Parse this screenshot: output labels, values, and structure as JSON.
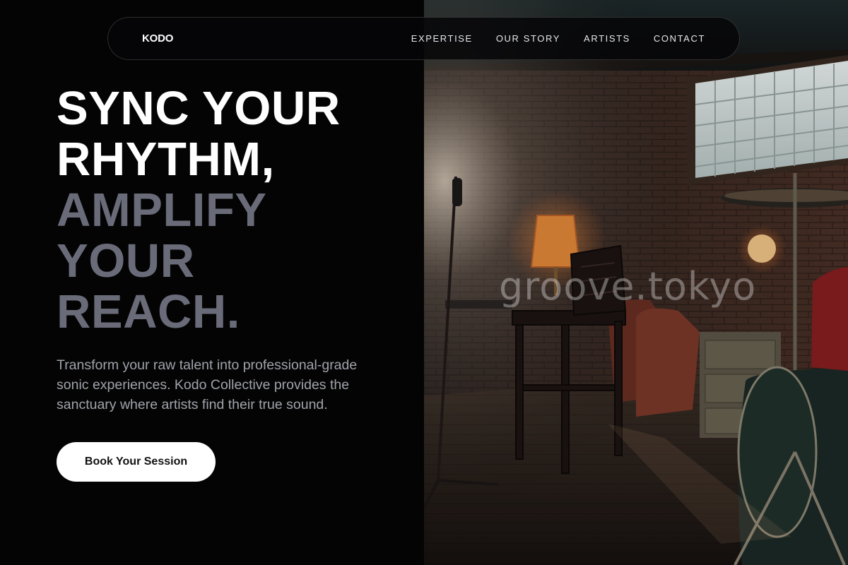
{
  "nav": {
    "brand": "KODO",
    "links": [
      "EXPERTISE",
      "OUR STORY",
      "ARTISTS",
      "CONTACT"
    ]
  },
  "hero": {
    "heading_lines_primary": [
      "SYNC YOUR",
      "RHYTHM,"
    ],
    "heading_lines_secondary": [
      "AMPLIFY",
      "YOUR",
      "REACH."
    ],
    "description": "Transform your raw talent into professional-grade sonic experiences. Kodo Collective provides the sanctuary where artists find their true sound.",
    "cta_label": "Book Your Session"
  },
  "photo": {
    "watermark": "groove.tokyo"
  },
  "colors": {
    "background": "#040404",
    "heading_primary": "#ffffff",
    "heading_secondary": "#696b79",
    "body_text": "#a0a3ab",
    "cta_background": "#ffffff"
  }
}
